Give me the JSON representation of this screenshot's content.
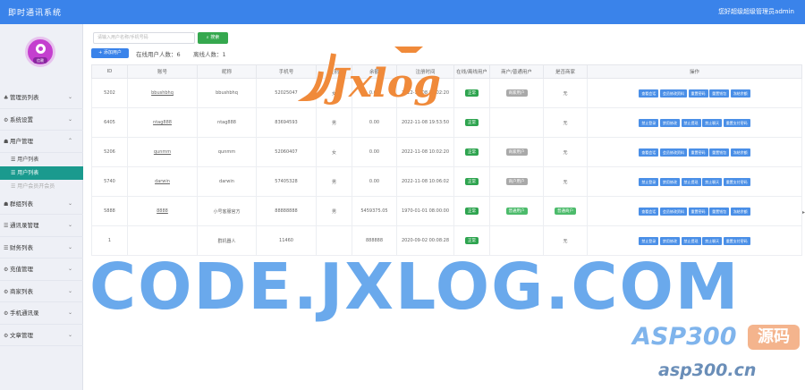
{
  "app_title": "即时通讯系统",
  "user_info": "您好超级超级管理员admin",
  "sidebar": {
    "avatar_badge": "信赖",
    "items": [
      {
        "icon": "user-icon",
        "glyph": "♣",
        "label": "管理员列表",
        "chevron": "⌄"
      },
      {
        "icon": "gear-icon",
        "glyph": "⚙",
        "label": "系统设置",
        "chevron": "⌄"
      },
      {
        "icon": "users-icon",
        "glyph": "☗",
        "label": "用户管理",
        "chevron": "⌃",
        "children": [
          {
            "label": "用户列表",
            "active": false
          },
          {
            "label": "用户列表",
            "active": true
          },
          {
            "label": "用户会员开会员",
            "active": false
          }
        ]
      },
      {
        "icon": "group-icon",
        "glyph": "☗",
        "label": "群组列表",
        "chevron": "⌄"
      },
      {
        "icon": "list-icon",
        "glyph": "☰",
        "label": "通讯录管理",
        "chevron": "⌄"
      },
      {
        "icon": "wallet-icon",
        "glyph": "☰",
        "label": "财务列表",
        "chevron": "⌄"
      },
      {
        "icon": "gear-icon",
        "glyph": "⚙",
        "label": "充值管理",
        "chevron": "⌄"
      },
      {
        "icon": "gear-icon",
        "glyph": "⚙",
        "label": "商家列表",
        "chevron": "⌄"
      },
      {
        "icon": "gear-icon",
        "glyph": "⚙",
        "label": "手机通讯录",
        "chevron": "⌄"
      },
      {
        "icon": "gear-icon",
        "glyph": "⚙",
        "label": "文章管理",
        "chevron": "⌄"
      }
    ]
  },
  "toolbar": {
    "search_placeholder": "请输入用户名称/手机号码",
    "search_label": "搜索",
    "add_label": "+ 添加用户",
    "online_label": "在线用户人数：6",
    "offline_label": "离线人数：1"
  },
  "table": {
    "headers": [
      "ID",
      "账号",
      "昵称",
      "手机号",
      "性别",
      "余额",
      "注册时间",
      "在线/离线用户",
      "商户/普通用户",
      "是否商家",
      "操作"
    ],
    "rows": [
      {
        "id": "5202",
        "account": "bbushbhq",
        "nick": "bbushbhq",
        "phone": "52025047",
        "gender": "女",
        "balance": "0.00",
        "time": "2022-11-08 10:02:20",
        "online": "正常",
        "type": "商家用户",
        "is_merchant": "无"
      },
      {
        "id": "6405",
        "account": "ntag888",
        "nick": "ntag888",
        "phone": "83694593",
        "gender": "男",
        "balance": "0.00",
        "time": "2022-11-08 19:53:50",
        "online": "正常",
        "type": "",
        "is_merchant": "无"
      },
      {
        "id": "5206",
        "account": "qunmm",
        "nick": "qunmm",
        "phone": "52060407",
        "gender": "女",
        "balance": "0.00",
        "time": "2022-11-08 10:02:20",
        "online": "正常",
        "type": "商家用户",
        "is_merchant": "无"
      },
      {
        "id": "5740",
        "account": "darwin",
        "nick": "darwin",
        "phone": "57405328",
        "gender": "男",
        "balance": "0.00",
        "time": "2022-11-08 10:06:02",
        "online": "正常",
        "type": "商户用户",
        "is_merchant": "无"
      },
      {
        "id": "5888",
        "account": "8888",
        "nick": "小号客服官方",
        "phone": "88888888",
        "gender": "男",
        "balance": "5459375.05",
        "time": "1970-01-01 08:00:00",
        "online": "正常",
        "type": "普通用户",
        "is_merchant": "普通商户"
      },
      {
        "id": "1",
        "account": "",
        "nick": "群机器人",
        "phone": "11460",
        "gender": "",
        "balance": "888888",
        "time": "2020-09-02 00:08:28",
        "online": "正常",
        "type": "",
        "is_merchant": "无"
      }
    ],
    "actions_long": [
      "查看会话",
      "会员修改资料",
      "重置密码",
      "重置钱包",
      "冻结余额"
    ],
    "actions_short": [
      "禁止登录",
      "禁用修改",
      "禁止提现",
      "禁止聊天",
      "重置支付密码"
    ]
  },
  "watermarks": {
    "logo_text": "Jxlog",
    "big_text": "CODE.JXLOG.COM",
    "asp_text": "ASP300",
    "asp_badge": "源码",
    "asp_url": "asp300.cn"
  },
  "colors": {
    "primary": "#3a83ea",
    "success": "#2ea44f",
    "active_menu": "#1a9a8e"
  }
}
